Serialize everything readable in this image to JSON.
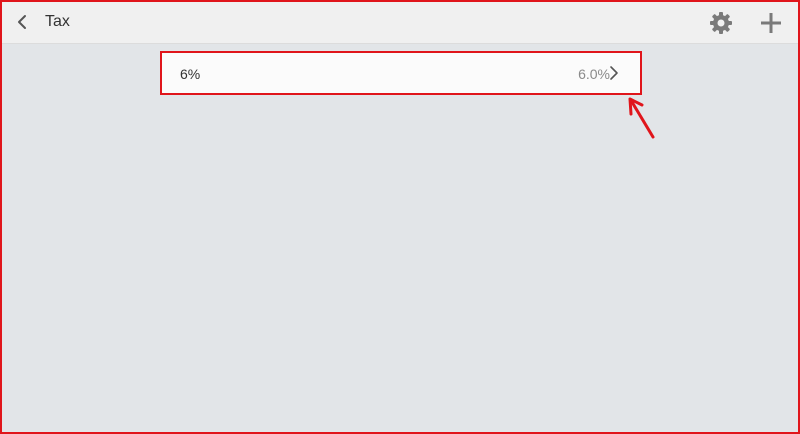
{
  "header": {
    "title": "Tax",
    "back_icon": "chevron-left-icon",
    "settings_icon": "gear-icon",
    "add_icon": "plus-icon"
  },
  "tax_list": [
    {
      "name": "6%",
      "rate": "6.0%"
    }
  ],
  "colors": {
    "highlight": "#e0151b",
    "background": "#e2e5e8",
    "topbar": "#f0f0f0",
    "icon": "#7a7a7a"
  }
}
